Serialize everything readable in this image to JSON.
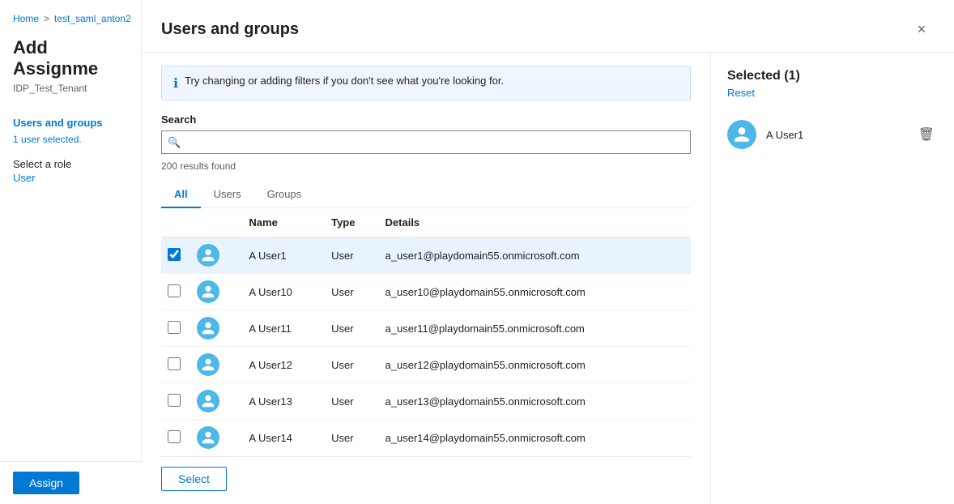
{
  "breadcrumb": {
    "home": "Home",
    "separator": ">",
    "page": "test_saml_anton2"
  },
  "left_panel": {
    "title": "Add Assignme",
    "subtitle": "IDP_Test_Tenant",
    "nav": {
      "users_and_groups": "Users and groups",
      "user_selected": "1 user selected.",
      "select_role": "Select a role",
      "role_value": "User"
    },
    "assign_button": "Assign"
  },
  "modal": {
    "title": "Users and groups",
    "close_icon": "×",
    "info_message": "Try changing or adding filters if you don't see what you're looking for.",
    "search_label": "Search",
    "search_placeholder": "",
    "results_count": "200 results found",
    "tabs": [
      {
        "label": "All",
        "active": true
      },
      {
        "label": "Users",
        "active": false
      },
      {
        "label": "Groups",
        "active": false
      }
    ],
    "table": {
      "columns": [
        "",
        "",
        "Name",
        "Type",
        "Details"
      ],
      "rows": [
        {
          "name": "A User1",
          "type": "User",
          "details": "a_user1@playdomain55.onmicrosoft.com",
          "selected": true
        },
        {
          "name": "A User10",
          "type": "User",
          "details": "a_user10@playdomain55.onmicrosoft.com",
          "selected": false
        },
        {
          "name": "A User11",
          "type": "User",
          "details": "a_user11@playdomain55.onmicrosoft.com",
          "selected": false
        },
        {
          "name": "A User12",
          "type": "User",
          "details": "a_user12@playdomain55.onmicrosoft.com",
          "selected": false
        },
        {
          "name": "A User13",
          "type": "User",
          "details": "a_user13@playdomain55.onmicrosoft.com",
          "selected": false
        },
        {
          "name": "A User14",
          "type": "User",
          "details": "a_user14@playdomain55.onmicrosoft.com",
          "selected": false
        }
      ]
    },
    "select_button": "Select"
  },
  "selected_panel": {
    "title": "Selected (1)",
    "reset": "Reset",
    "items": [
      {
        "name": "A User1"
      }
    ]
  }
}
